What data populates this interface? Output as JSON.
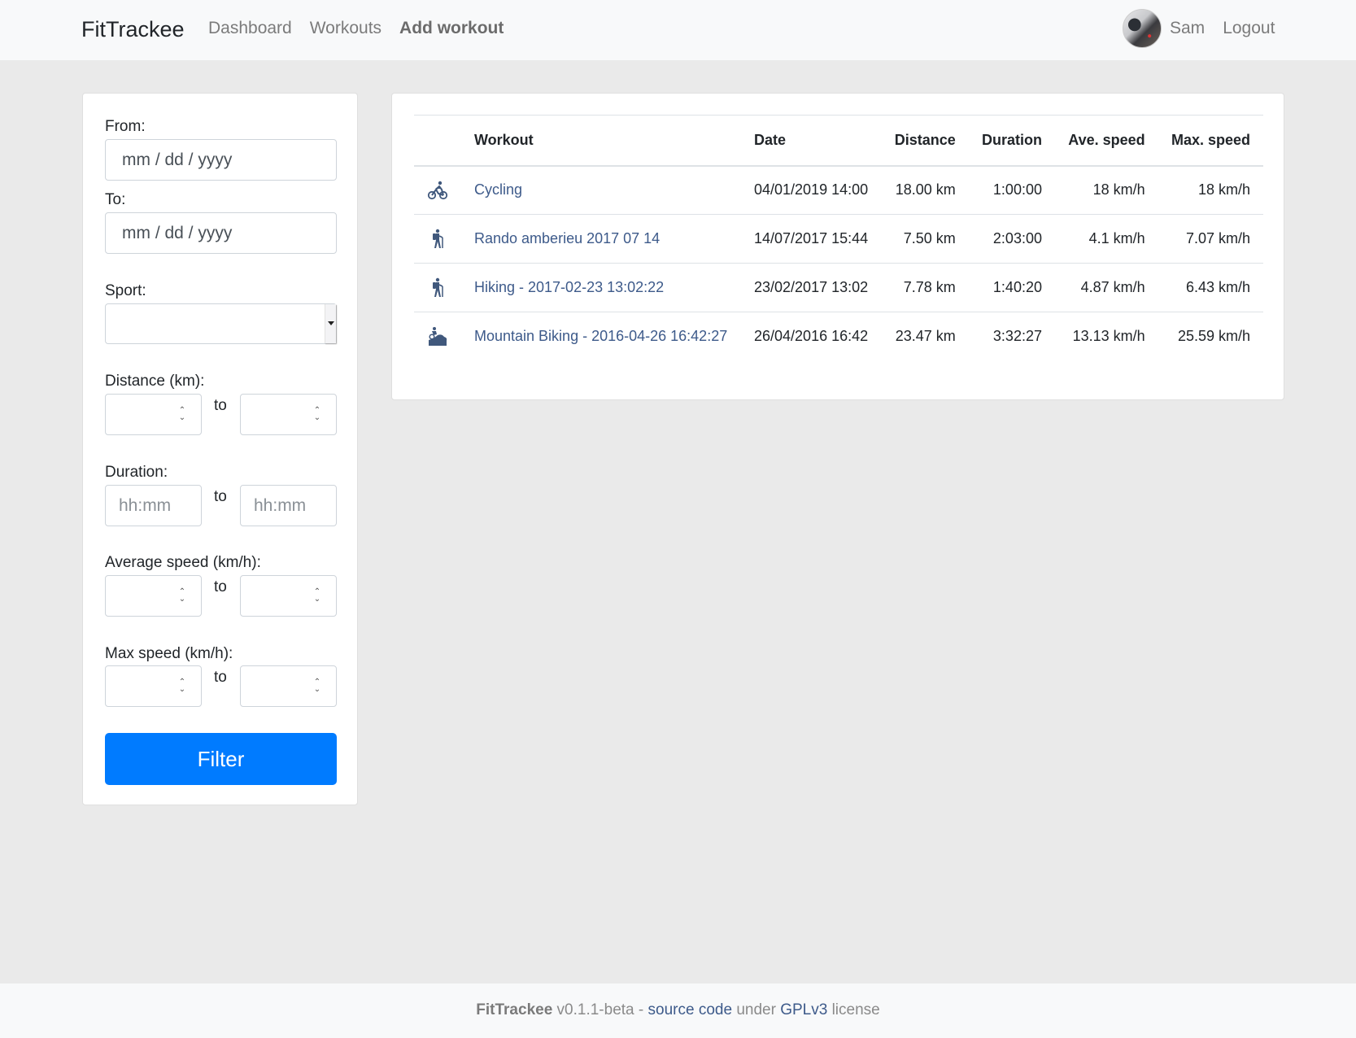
{
  "navbar": {
    "brand": "FitTrackee",
    "links": [
      {
        "label": "Dashboard"
      },
      {
        "label": "Workouts"
      },
      {
        "label": "Add workout"
      }
    ],
    "user": {
      "name": "Sam",
      "avatar": "user-avatar"
    },
    "logout": "Logout"
  },
  "filters": {
    "from_label": "From:",
    "from_placeholder": "mm / dd / yyyy",
    "to_label": "To:",
    "to_placeholder": "mm / dd / yyyy",
    "sport_label": "Sport:",
    "sport_value": "",
    "distance_label": "Distance (km):",
    "duration_label": "Duration:",
    "duration_placeholder": "hh:mm",
    "ave_speed_label": "Average speed (km/h):",
    "max_speed_label": "Max speed (km/h):",
    "to_separator": "to",
    "filter_button": "Filter"
  },
  "table": {
    "headers": [
      "",
      "Workout",
      "Date",
      "Distance",
      "Duration",
      "Ave. speed",
      "Max. speed"
    ],
    "rows": [
      {
        "icon": "cycling-icon",
        "workout": "Cycling",
        "date": "04/01/2019 14:00",
        "distance": "18.00 km",
        "duration": "1:00:00",
        "ave_speed": "18 km/h",
        "max_speed": "18 km/h"
      },
      {
        "icon": "hiking-icon",
        "workout": "Rando amberieu 2017 07 14",
        "date": "14/07/2017 15:44",
        "distance": "7.50 km",
        "duration": "2:03:00",
        "ave_speed": "4.1 km/h",
        "max_speed": "7.07 km/h"
      },
      {
        "icon": "hiking-icon",
        "workout": "Hiking - 2017-02-23 13:02:22",
        "date": "23/02/2017 13:02",
        "distance": "7.78 km",
        "duration": "1:40:20",
        "ave_speed": "4.87 km/h",
        "max_speed": "6.43 km/h"
      },
      {
        "icon": "mountain-biking-icon",
        "workout": "Mountain Biking - 2016-04-26 16:42:27",
        "date": "26/04/2016 16:42",
        "distance": "23.47 km",
        "duration": "3:32:27",
        "ave_speed": "13.13 km/h",
        "max_speed": "25.59 km/h"
      }
    ]
  },
  "footer": {
    "app_name": "FitTrackee",
    "version": "v0.1.1-beta",
    "separator": "-",
    "source_link": "source code",
    "under": "under",
    "license_link": "GPLv3",
    "license": "license"
  },
  "colors": {
    "primary": "#007bff",
    "link": "#3d5a8a",
    "icon": "#40587c"
  }
}
